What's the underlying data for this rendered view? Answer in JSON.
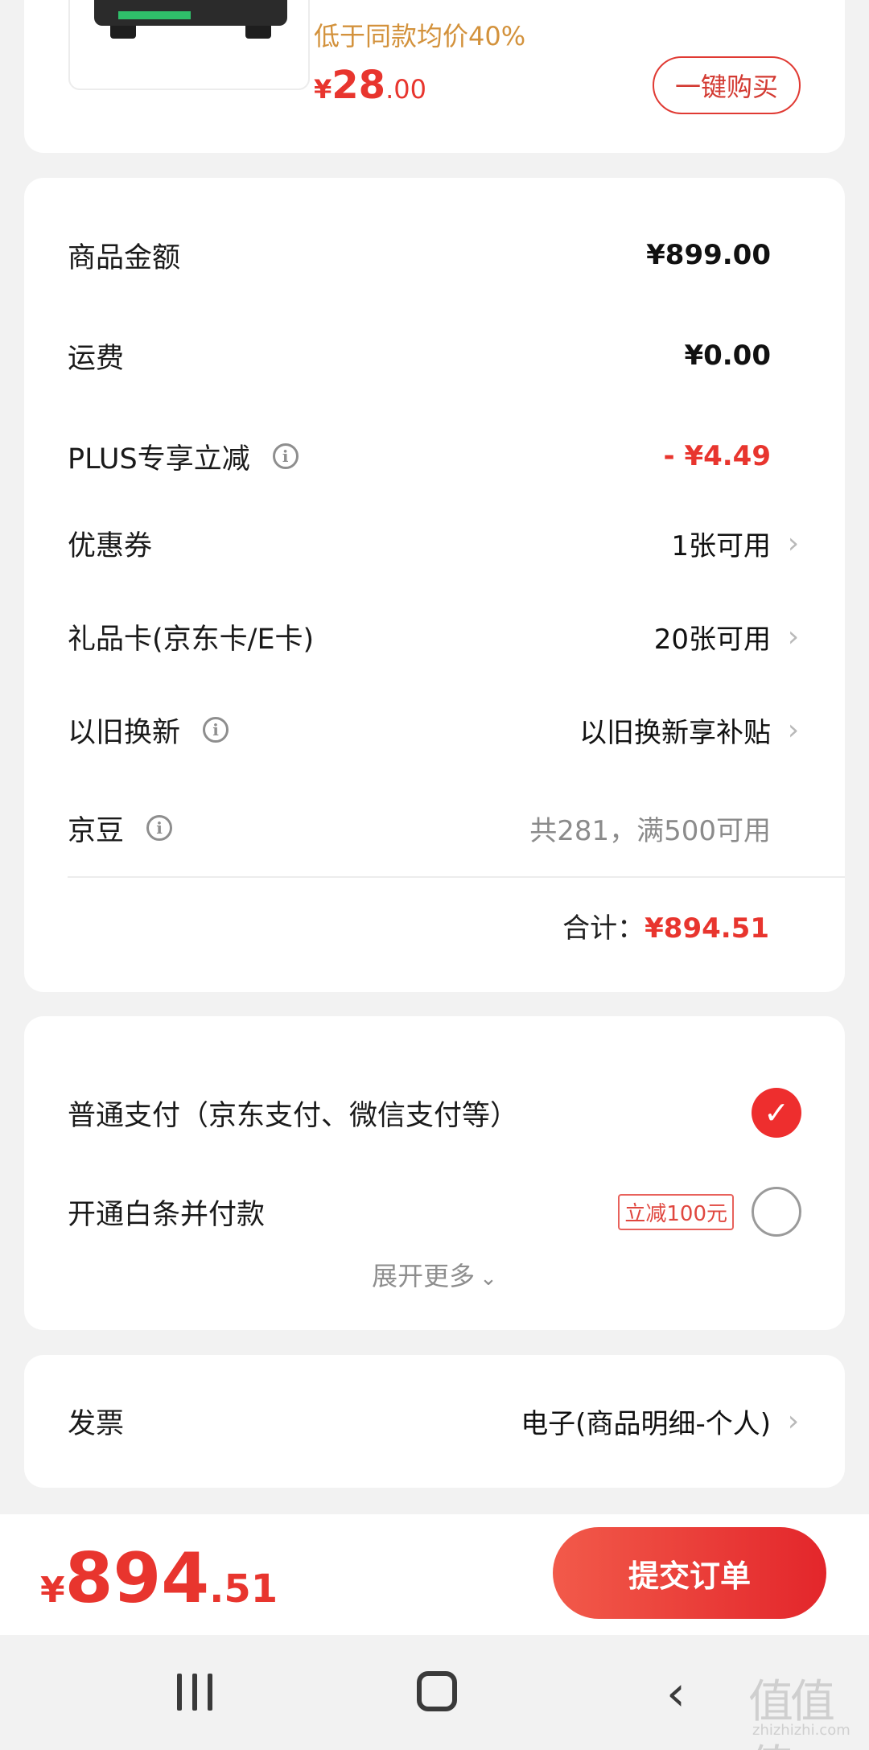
{
  "product": {
    "note": "低于同款均价40%",
    "price_symbol": "¥",
    "price_int": "28",
    "price_dec": ".00",
    "buy_button": "一键购买"
  },
  "summary": {
    "rows": [
      {
        "label": "商品金额",
        "value": "¥899.00"
      },
      {
        "label": "运费",
        "value": "¥0.00"
      },
      {
        "label": "PLUS专享立减",
        "value": "- ¥4.49"
      },
      {
        "label": "优惠券",
        "value": "1张可用"
      },
      {
        "label": "礼品卡(京东卡/E卡)",
        "value": "20张可用"
      },
      {
        "label": "以旧换新",
        "value": "以旧换新享补贴"
      },
      {
        "label": "京豆",
        "value": "共281，满500可用"
      }
    ],
    "total_label": "合计：",
    "total_value": "¥894.51"
  },
  "payment": {
    "options": [
      {
        "label": "普通支付（京东支付、微信支付等）",
        "selected": true
      },
      {
        "label": "开通白条并付款",
        "badge": "立减100元",
        "selected": false
      }
    ],
    "expand_label": "展开更多"
  },
  "invoice": {
    "label": "发票",
    "value": "电子(商品明细-个人)"
  },
  "footer": {
    "price_symbol": "¥",
    "price_int": "894",
    "price_dec": ".51",
    "submit_label": "提交订单"
  },
  "watermark": {
    "mark": "值值值",
    "url": "zhizhizhi.com"
  },
  "colors": {
    "accent": "#e8352e",
    "note": "#d3923c",
    "background": "#f2f2f2"
  }
}
